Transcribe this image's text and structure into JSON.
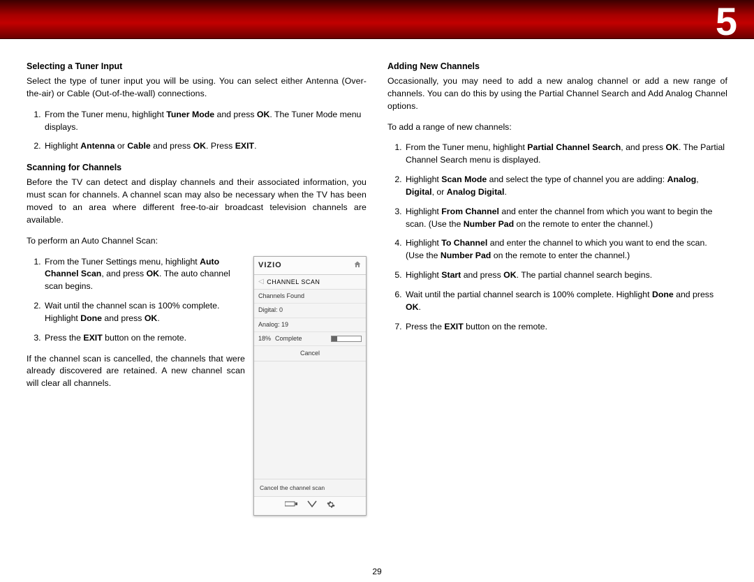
{
  "chapter": "5",
  "page_number": "29",
  "col1": {
    "h1": "Selecting a Tuner Input",
    "p1": "Select the type of tuner input you will be using. You can select either Antenna (Over-the-air) or Cable (Out-of-the-wall) connections.",
    "s1_1_a": "From the Tuner menu, highlight ",
    "s1_1_b": "Tuner Mode",
    "s1_1_c": " and press ",
    "s1_1_d": "OK",
    "s1_1_e": ". The Tuner Mode menu displays.",
    "s1_2_a": "Highlight ",
    "s1_2_b": "Antenna",
    "s1_2_c": " or ",
    "s1_2_d": "Cable",
    "s1_2_e": " and press ",
    "s1_2_f": "OK",
    "s1_2_g": ". Press ",
    "s1_2_h": "EXIT",
    "s1_2_i": ".",
    "h2": "Scanning for Channels",
    "p2": "Before the TV can detect and display channels and their associated information, you must scan for channels. A channel scan may also be necessary when the TV has been moved to an area where different free-to-air broadcast television channels are available.",
    "p3": "To perform an Auto Channel Scan:",
    "s2_1_a": "From the Tuner Settings menu, highlight ",
    "s2_1_b": "Auto Channel Scan",
    "s2_1_c": ", and press ",
    "s2_1_d": "OK",
    "s2_1_e": ". The auto channel scan begins.",
    "s2_2_a": "Wait until the channel scan is 100% complete. Highlight ",
    "s2_2_b": "Done",
    "s2_2_c": " and press ",
    "s2_2_d": "OK",
    "s2_2_e": ".",
    "s2_3_a": "Press the ",
    "s2_3_b": "EXIT",
    "s2_3_c": " button on the remote.",
    "p4": "If the channel scan is cancelled, the channels that were already discovered are retained. A new channel scan will clear all channels."
  },
  "menu": {
    "logo": "VIZIO",
    "title": "CHANNEL SCAN",
    "found": "Channels Found",
    "digital": "Digital:   0",
    "analog": "Analog: 19",
    "pct": "18%",
    "complete": "Complete",
    "cancel": "Cancel",
    "hint": "Cancel the channel scan"
  },
  "col2": {
    "h1": "Adding New Channels",
    "p1": "Occasionally, you may need to add a new analog channel or add a new range of channels. You can do this by using the Partial Channel Search and Add Analog Channel options.",
    "p2": "To add a range of new channels:",
    "s1_a": "From the Tuner menu, highlight ",
    "s1_b": "Partial Channel Search",
    "s1_c": ", and press ",
    "s1_d": "OK",
    "s1_e": ". The Partial Channel Search menu is displayed.",
    "s2_a": "Highlight ",
    "s2_b": "Scan Mode",
    "s2_c": " and select the type of channel you are adding: ",
    "s2_d": "Analog",
    "s2_e": ", ",
    "s2_f": "Digital",
    "s2_g": ", or ",
    "s2_h": "Analog Digital",
    "s2_i": ".",
    "s3_a": "Highlight ",
    "s3_b": "From Channel",
    "s3_c": " and enter the channel from which you want to begin the scan. (Use the ",
    "s3_d": "Number Pad",
    "s3_e": " on the remote to enter the channel.)",
    "s4_a": "Highlight ",
    "s4_b": "To Channel",
    "s4_c": " and enter the channel to which you want to end the scan. (Use the ",
    "s4_d": "Number Pad",
    "s4_e": " on the remote to enter the channel.)",
    "s5_a": "Highlight ",
    "s5_b": "Start",
    "s5_c": " and press ",
    "s5_d": "OK",
    "s5_e": ". The partial channel search begins.",
    "s6_a": "Wait until the partial channel search is 100% complete. Highlight ",
    "s6_b": "Done",
    "s6_c": " and press ",
    "s6_d": "OK",
    "s6_e": ".",
    "s7_a": "Press the ",
    "s7_b": "EXIT",
    "s7_c": " button on the remote."
  }
}
